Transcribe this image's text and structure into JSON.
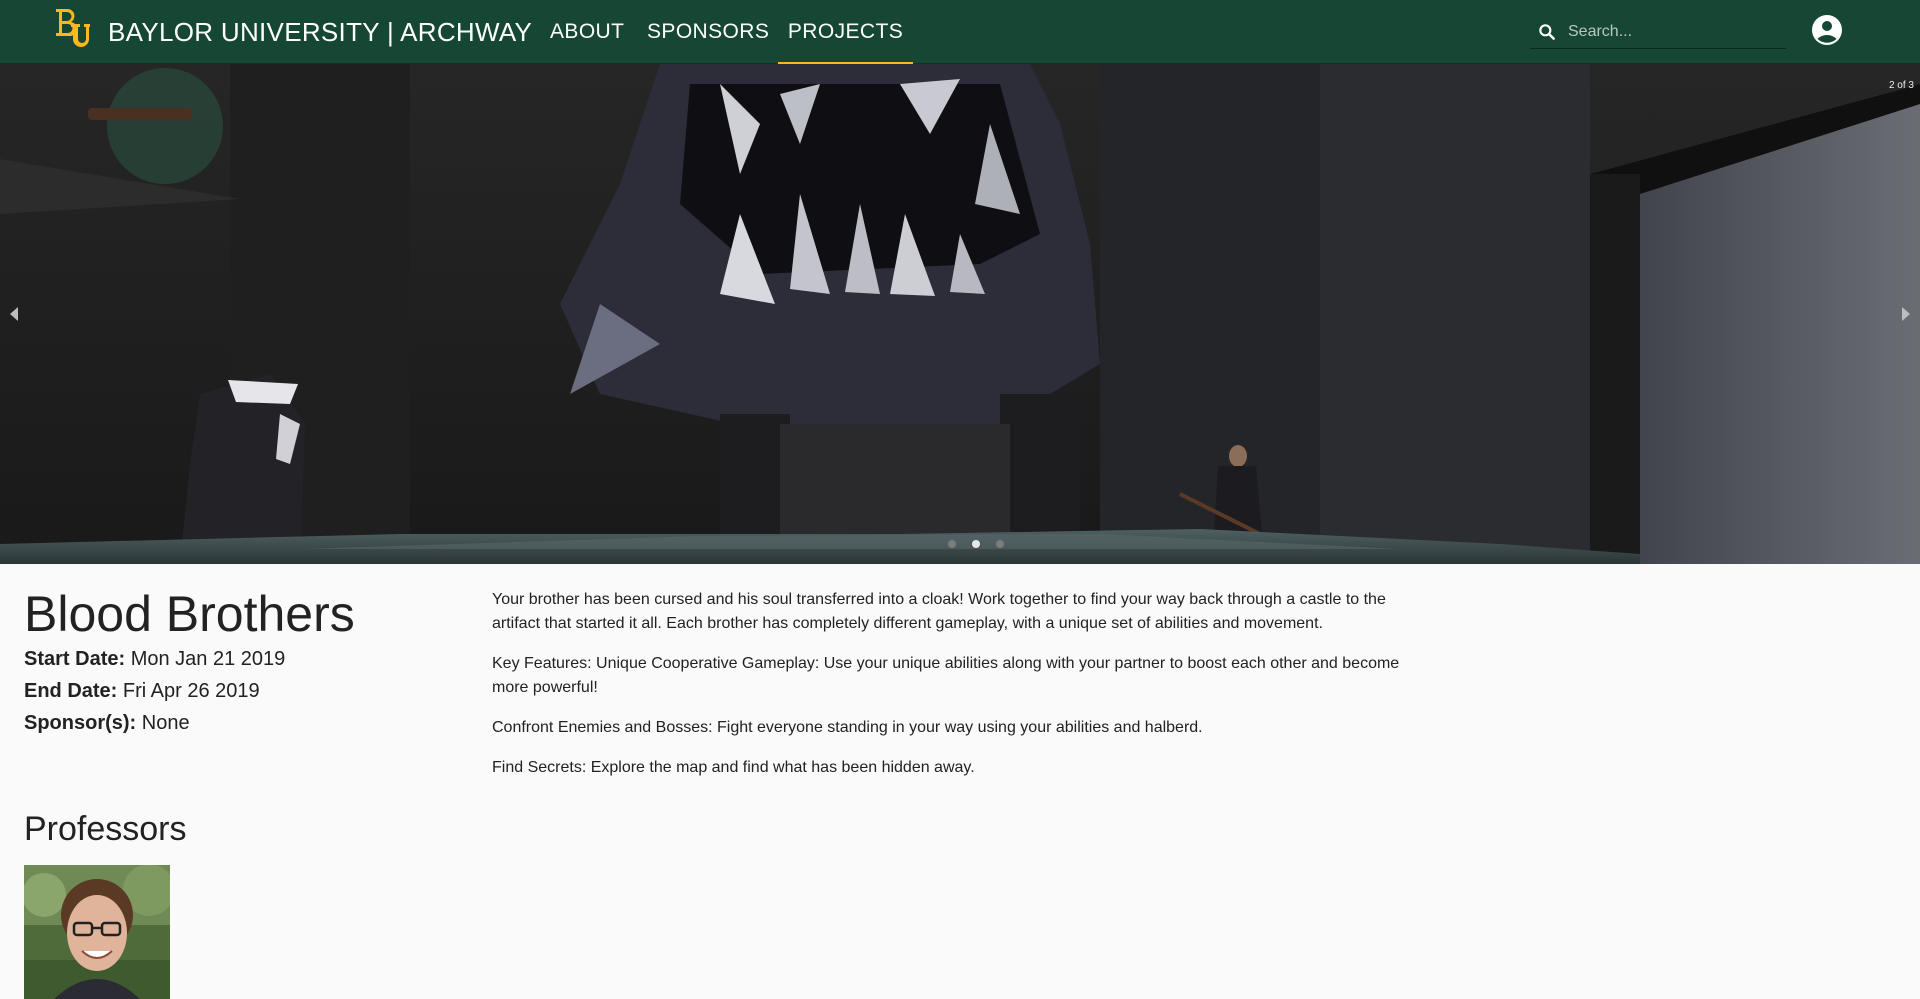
{
  "header": {
    "brand": "BAYLOR UNIVERSITY | ARCHWAY",
    "logo_icon": "baylor-bu-logo",
    "nav": [
      {
        "label": "ABOUT",
        "active": false
      },
      {
        "label": "SPONSORS",
        "active": false
      },
      {
        "label": "PROJECTS",
        "active": true
      }
    ],
    "search": {
      "placeholder": "Search...",
      "value": "",
      "icon": "search-icon"
    },
    "account_icon": "account-circle-icon",
    "colors": {
      "bar": "#154734",
      "accent": "#FFB81C"
    }
  },
  "carousel": {
    "counter": "2 of 3",
    "total": 3,
    "current_index": 1,
    "left_arrow_icon": "chevron-left-icon",
    "right_arrow_icon": "chevron-right-icon"
  },
  "project": {
    "title": "Blood Brothers",
    "start_label": "Start Date:",
    "start_value": "Mon Jan 21 2019",
    "end_label": "End Date:",
    "end_value": "Fri Apr 26 2019",
    "sponsor_label": "Sponsor(s):",
    "sponsor_value": "None",
    "description": [
      "Your brother has been cursed and his soul transferred into a cloak! Work together to find your way back through a castle to the artifact that started it all. Each brother has completely different gameplay, with a unique set of abilities and movement.",
      "Key Features: Unique Cooperative Gameplay: Use your unique abilities along with your partner to boost each other and become more powerful!",
      "Confront Enemies and Bosses: Fight everyone standing in your way using your abilities and halberd.",
      "Find Secrets: Explore the map and find what has been hidden away."
    ]
  },
  "professors": {
    "heading": "Professors"
  }
}
